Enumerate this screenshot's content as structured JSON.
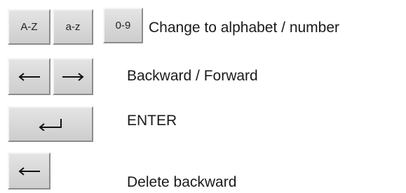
{
  "rows": {
    "alphabet": {
      "keys": [
        "A-Z",
        "a-z",
        "0-9"
      ],
      "description": "Change to alphabet / number"
    },
    "navigation": {
      "keys": [
        "left-arrow-icon",
        "right-arrow-icon"
      ],
      "description": "Backward / Forward"
    },
    "enter": {
      "key": "enter-icon",
      "description": "ENTER"
    },
    "delete": {
      "key": "left-arrow-icon",
      "description": "Delete backward"
    }
  }
}
